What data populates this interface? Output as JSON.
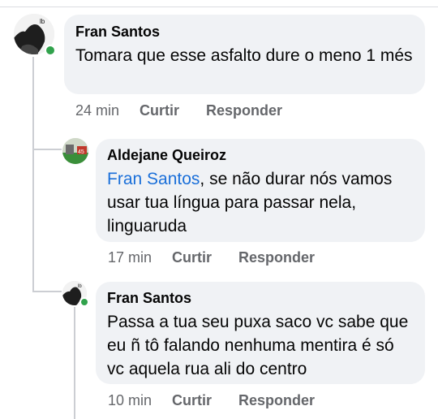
{
  "comments": [
    {
      "author": "Fran Santos",
      "text": "Tomara que esse asfalto  dure o meno 1 més",
      "time": "24 min",
      "like": "Curtir",
      "reply": "Responder",
      "online": true
    }
  ],
  "replies": [
    {
      "author": "Aldejane Queiroz",
      "mention": "Fran Santos",
      "text": ", se não durar nós vamos usar tua língua para passar nela, linguaruda",
      "time": "17 min",
      "like": "Curtir",
      "reply": "Responder"
    },
    {
      "author": "Fran Santos",
      "text": "Passa  a tua seu puxa saco vc sabe que eu ñ tô falando nenhuma mentira é só vc aquela rua  ali do centro",
      "time": "10 min",
      "like": "Curtir",
      "reply": "Responder",
      "online": true
    }
  ],
  "colors": {
    "bubble": "#f0f2f5",
    "mention": "#1a6fd9",
    "meta": "#65676b",
    "online": "#31a24c"
  }
}
